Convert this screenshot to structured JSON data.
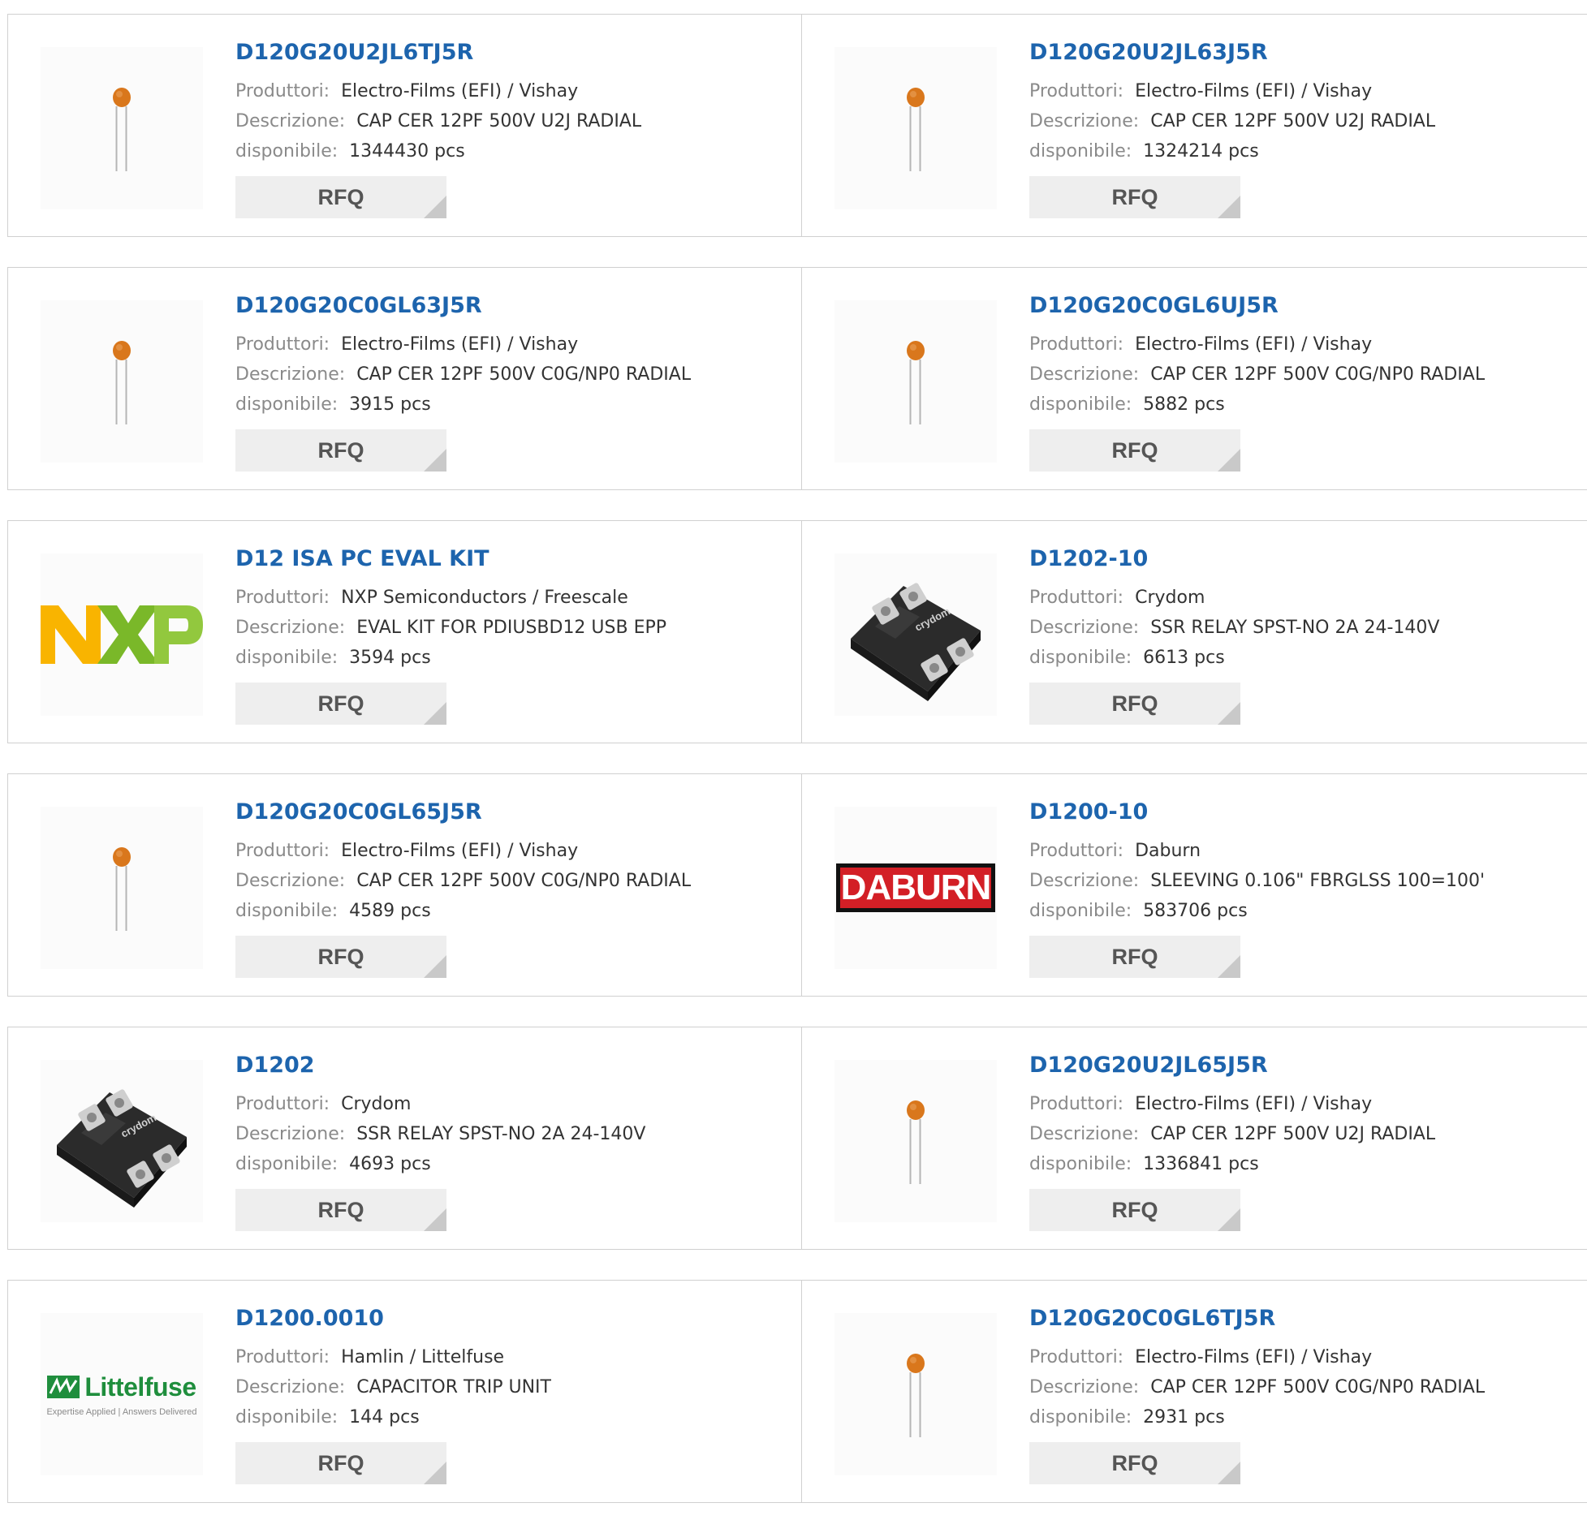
{
  "labels": {
    "manufacturer": "Produttori:",
    "description": "Descrizione:",
    "available": "disponibile:",
    "rfq": "RFQ"
  },
  "products": [
    {
      "part": "D120G20U2JL6TJ5R",
      "manufacturer": "Electro-Films (EFI) / Vishay",
      "description": "CAP CER 12PF 500V U2J RADIAL",
      "available": "1344430 pcs",
      "image": "capacitor"
    },
    {
      "part": "D120G20U2JL63J5R",
      "manufacturer": "Electro-Films (EFI) / Vishay",
      "description": "CAP CER 12PF 500V U2J RADIAL",
      "available": "1324214 pcs",
      "image": "capacitor"
    },
    {
      "part": "D120G20C0GL63J5R",
      "manufacturer": "Electro-Films (EFI) / Vishay",
      "description": "CAP CER 12PF 500V C0G/NP0 RADIAL",
      "available": "3915 pcs",
      "image": "capacitor"
    },
    {
      "part": "D120G20C0GL6UJ5R",
      "manufacturer": "Electro-Films (EFI) / Vishay",
      "description": "CAP CER 12PF 500V C0G/NP0 RADIAL",
      "available": "5882 pcs",
      "image": "capacitor"
    },
    {
      "part": "D12 ISA PC EVAL KIT",
      "manufacturer": "NXP Semiconductors / Freescale",
      "description": "EVAL KIT FOR PDIUSBD12 USB EPP",
      "available": "3594 pcs",
      "image": "nxp-logo"
    },
    {
      "part": "D1202-10",
      "manufacturer": "Crydom",
      "description": "SSR RELAY SPST-NO 2A 24-140V",
      "available": "6613 pcs",
      "image": "relay"
    },
    {
      "part": "D120G20C0GL65J5R",
      "manufacturer": "Electro-Films (EFI) / Vishay",
      "description": "CAP CER 12PF 500V C0G/NP0 RADIAL",
      "available": "4589 pcs",
      "image": "capacitor"
    },
    {
      "part": "D1200-10",
      "manufacturer": "Daburn",
      "description": "SLEEVING 0.106\" FBRGLSS 100=100'",
      "available": "583706 pcs",
      "image": "daburn-logo"
    },
    {
      "part": "D1202",
      "manufacturer": "Crydom",
      "description": "SSR RELAY SPST-NO 2A 24-140V",
      "available": "4693 pcs",
      "image": "relay"
    },
    {
      "part": "D120G20U2JL65J5R",
      "manufacturer": "Electro-Films (EFI) / Vishay",
      "description": "CAP CER 12PF 500V U2J RADIAL",
      "available": "1336841 pcs",
      "image": "capacitor"
    },
    {
      "part": "D1200.0010",
      "manufacturer": "Hamlin / Littelfuse",
      "description": "CAPACITOR TRIP UNIT",
      "available": "144 pcs",
      "image": "littelfuse-logo"
    },
    {
      "part": "D120G20C0GL6TJ5R",
      "manufacturer": "Electro-Films (EFI) / Vishay",
      "description": "CAP CER 12PF 500V C0G/NP0 RADIAL",
      "available": "2931 pcs",
      "image": "capacitor"
    }
  ],
  "logos": {
    "daburn": "DABURN",
    "littelfuse_name": "Littelfuse",
    "littelfuse_tagline": "Expertise Applied | Answers Delivered",
    "crydom": "crydom"
  },
  "colors": {
    "link": "#1d64ad",
    "label": "#8a8a8a",
    "value": "#333333",
    "button_bg": "#eeeeee",
    "border": "#d0d0d0",
    "capacitor": "#d9771c",
    "daburn_red": "#d31f26",
    "littelfuse_green": "#1f8e3d"
  }
}
